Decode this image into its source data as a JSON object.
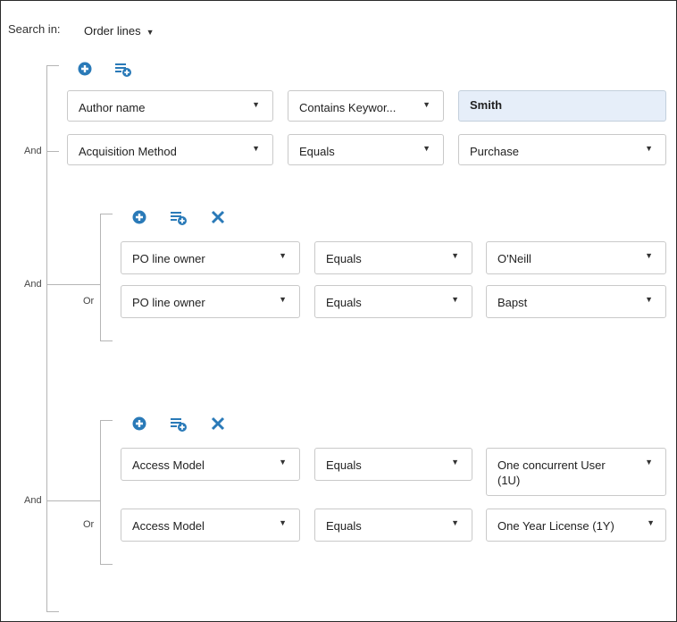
{
  "search": {
    "label": "Search in:",
    "scope": "Order lines"
  },
  "colors": {
    "icon_blue": "#2a7ab8",
    "input_bg": "#e6eef9",
    "tree_line": "#b5b5b5"
  },
  "group_icons": [
    "add-condition-icon",
    "add-group-icon"
  ],
  "subgroup_icons": [
    "add-condition-icon",
    "add-group-icon",
    "remove-group-icon"
  ],
  "root": {
    "connector_and": "And",
    "rows": [
      {
        "field": "Author name",
        "operator": "Contains Keywor...",
        "value": "Smith",
        "value_type": "text"
      },
      {
        "connector": "And",
        "field": "Acquisition Method",
        "operator": "Equals",
        "value": "Purchase",
        "value_type": "select"
      }
    ]
  },
  "groups": [
    {
      "outer_connector": "And",
      "inner_connector": "Or",
      "rows": [
        {
          "field": "PO line owner",
          "operator": "Equals",
          "value": "O'Neill"
        },
        {
          "field": "PO line owner",
          "operator": "Equals",
          "value": "Bapst"
        }
      ]
    },
    {
      "outer_connector": "And",
      "inner_connector": "Or",
      "rows": [
        {
          "field": "Access Model",
          "operator": "Equals",
          "value": "One concurrent User\n(1U)"
        },
        {
          "field": "Access Model",
          "operator": "Equals",
          "value": "One Year License (1Y)"
        }
      ]
    }
  ]
}
